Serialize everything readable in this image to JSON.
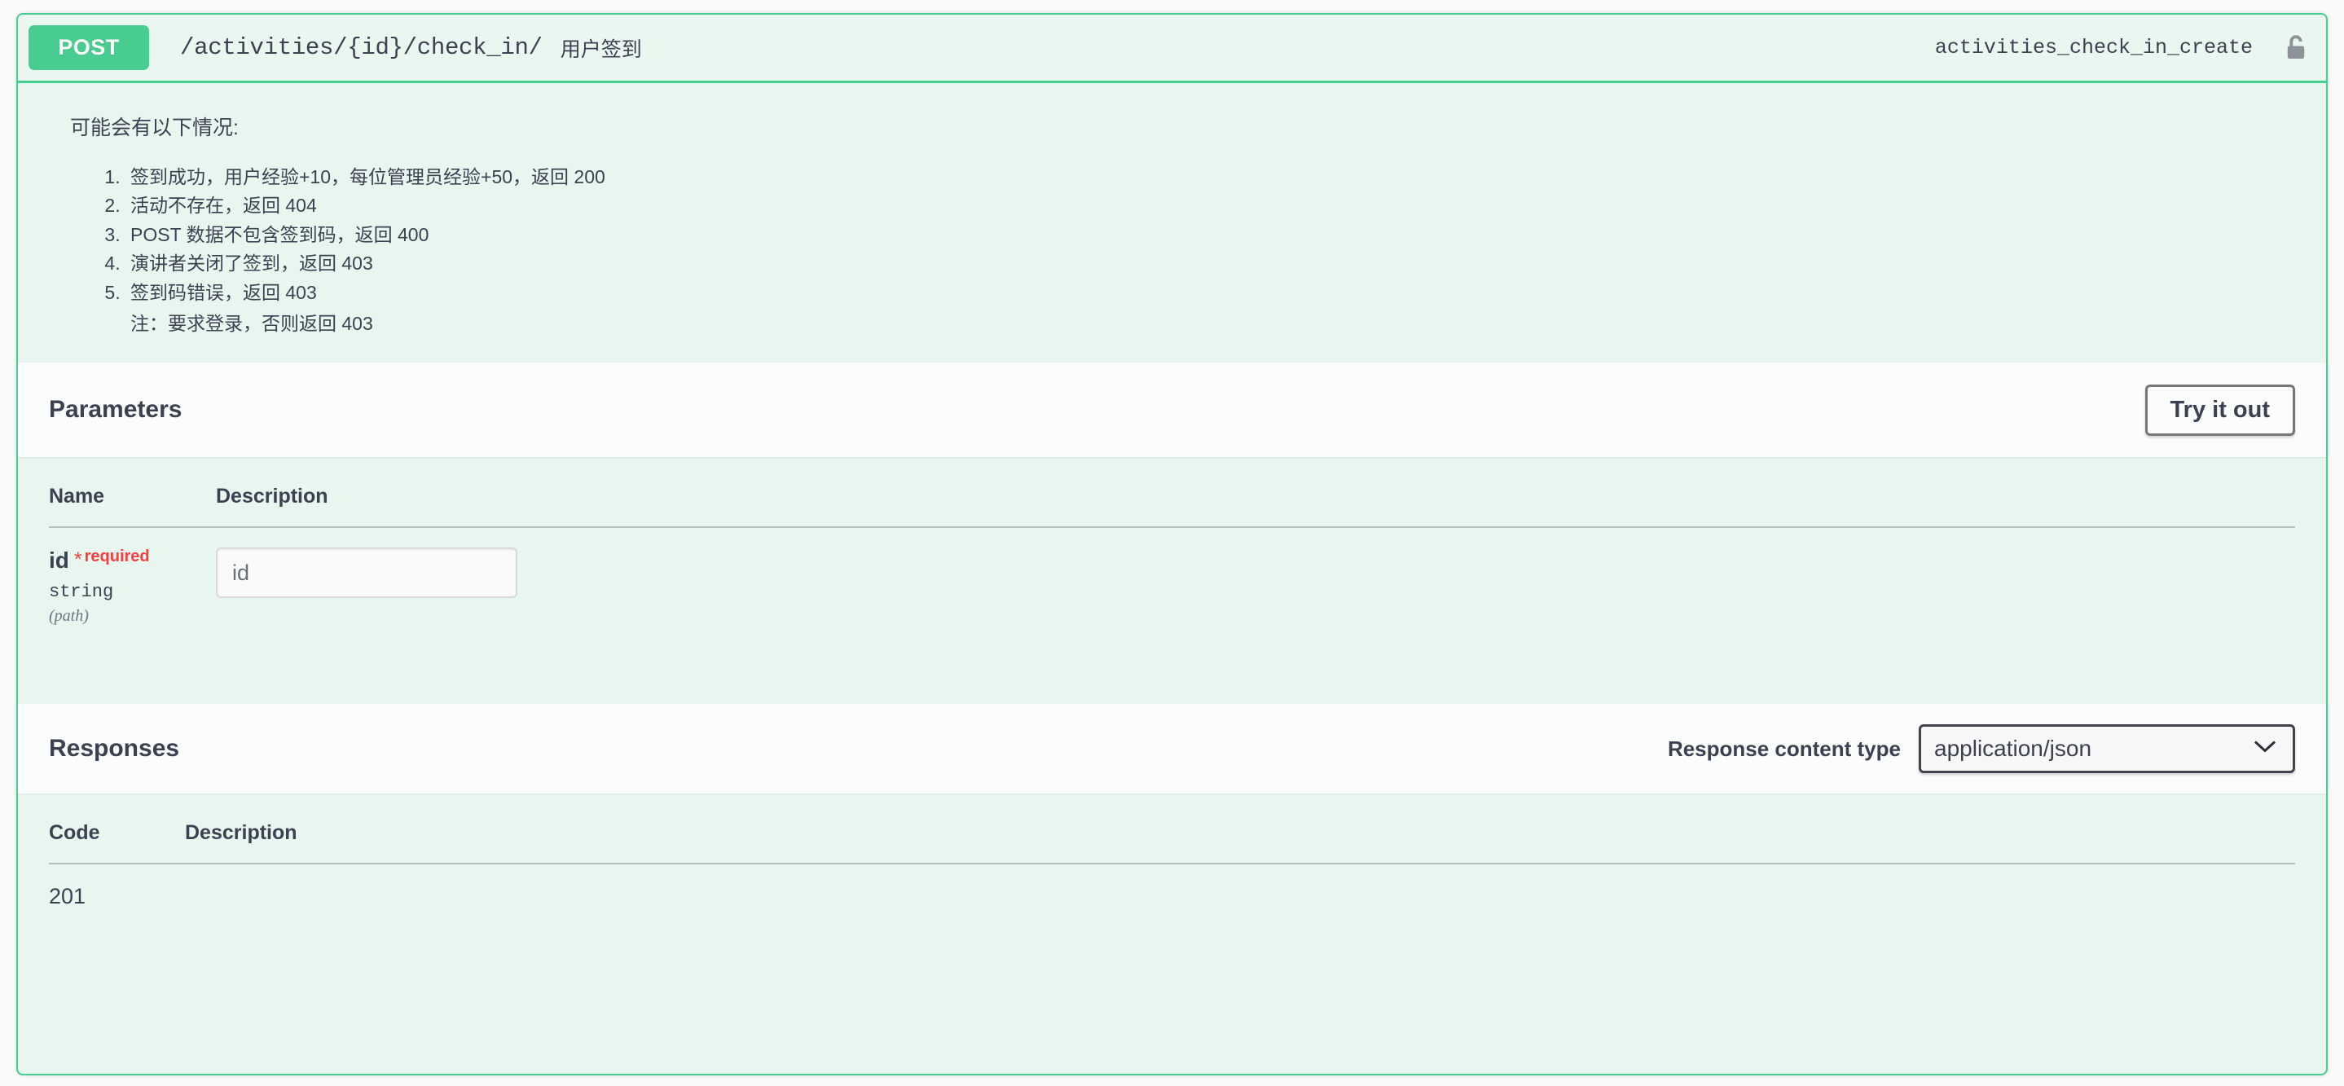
{
  "operation": {
    "method": "POST",
    "path": "/activities/{id}/check_in/",
    "summary": "用户签到",
    "operation_id": "activities_check_in_create",
    "auth_icon": "unlocked-padlock-icon",
    "accent_color": "#49cc90",
    "block_background": "#e8f6f0",
    "description": {
      "intro": "可能会有以下情况:",
      "items": [
        "签到成功，用户经验+10，每位管理员经验+50，返回 200",
        "活动不存在，返回 404",
        "POST 数据不包含签到码，返回 400",
        "演讲者关闭了签到，返回 403",
        "签到码错误，返回 403"
      ],
      "note": "注：要求登录，否则返回 403"
    }
  },
  "parameters": {
    "title": "Parameters",
    "try_it_out_label": "Try it out",
    "columns": [
      "Name",
      "Description"
    ],
    "rows": [
      {
        "name": "id",
        "required_star": "*",
        "required_label": "required",
        "type": "string",
        "in": "(path)",
        "input_value": "",
        "input_placeholder": "id"
      }
    ]
  },
  "responses": {
    "title": "Responses",
    "content_type_label": "Response content type",
    "content_type_value": "application/json",
    "columns": [
      "Code",
      "Description"
    ],
    "rows": [
      {
        "code": "201",
        "description": ""
      }
    ]
  }
}
